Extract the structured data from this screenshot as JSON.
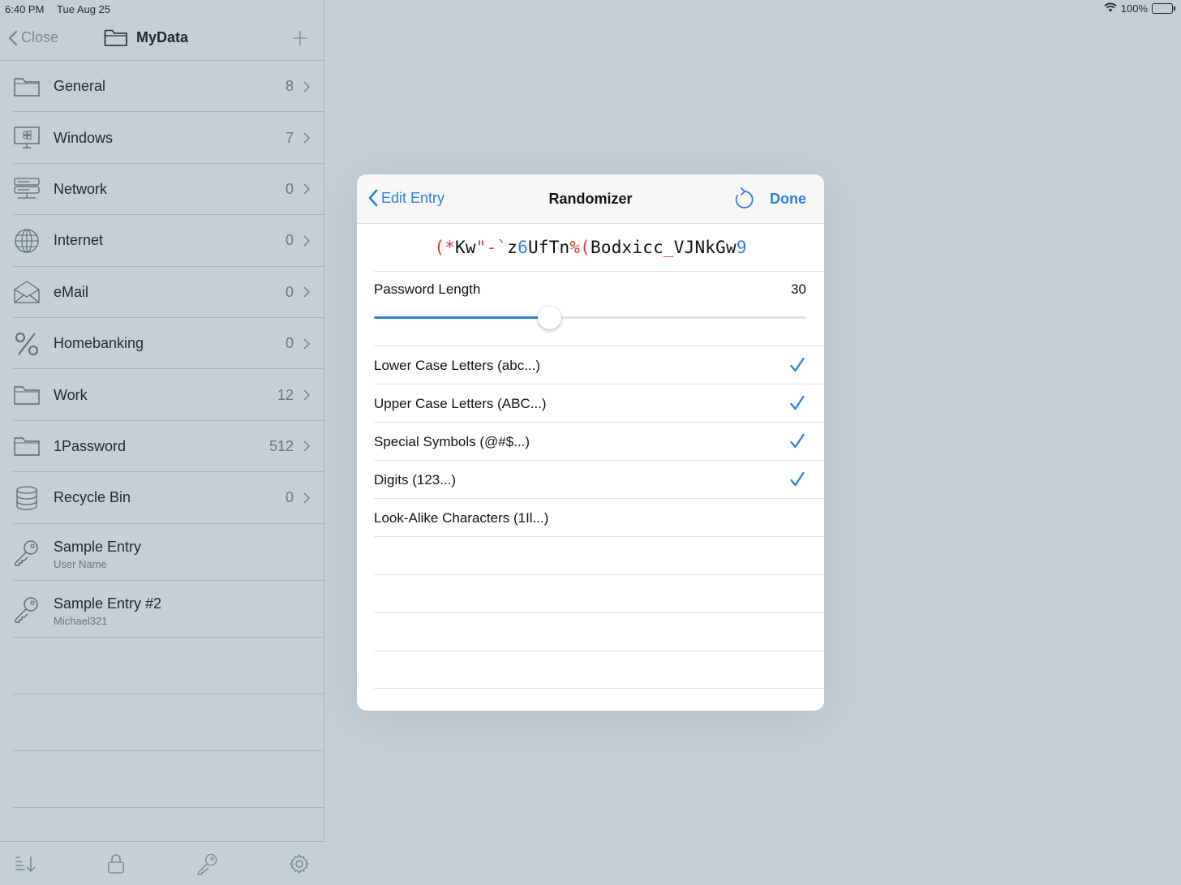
{
  "status_bar": {
    "time": "6:40 PM",
    "date": "Tue Aug 25",
    "battery": "100%"
  },
  "sidebar": {
    "back_label": "Close",
    "title": "MyData",
    "items": [
      {
        "label": "General",
        "count": "8",
        "icon": "folder-icon"
      },
      {
        "label": "Windows",
        "count": "7",
        "icon": "windows-computer-icon"
      },
      {
        "label": "Network",
        "count": "0",
        "icon": "server-icon"
      },
      {
        "label": "Internet",
        "count": "0",
        "icon": "globe-icon"
      },
      {
        "label": "eMail",
        "count": "0",
        "icon": "envelope-icon"
      },
      {
        "label": "Homebanking",
        "count": "0",
        "icon": "percent-icon"
      },
      {
        "label": "Work",
        "count": "12",
        "icon": "folder-icon"
      },
      {
        "label": "1Password",
        "count": "512",
        "icon": "folder-icon"
      },
      {
        "label": "Recycle Bin",
        "count": "0",
        "icon": "database-icon"
      }
    ],
    "entries": [
      {
        "title": "Sample Entry",
        "subtitle": "User Name",
        "icon": "key-icon"
      },
      {
        "title": "Sample Entry #2",
        "subtitle": "Michael321",
        "icon": "key-icon"
      }
    ]
  },
  "modal": {
    "back_label": "Edit Entry",
    "title": "Randomizer",
    "done_label": "Done",
    "password": "(*Kw\"-`z6UfTn%(Bodxicc_VJNkGw9",
    "length_label": "Password Length",
    "length_value": "30",
    "slider_fraction": 0.405,
    "options": [
      {
        "label": "Lower Case Letters (abc...)",
        "checked": true
      },
      {
        "label": "Upper Case Letters (ABC...)",
        "checked": true
      },
      {
        "label": "Special Symbols (@#$...)",
        "checked": true
      },
      {
        "label": "Digits (123...)",
        "checked": true
      },
      {
        "label": "Look-Alike Characters (1Il...)",
        "checked": false
      }
    ]
  },
  "colors": {
    "accent": "#2f7fe0",
    "symbol": "#d63a3a"
  }
}
